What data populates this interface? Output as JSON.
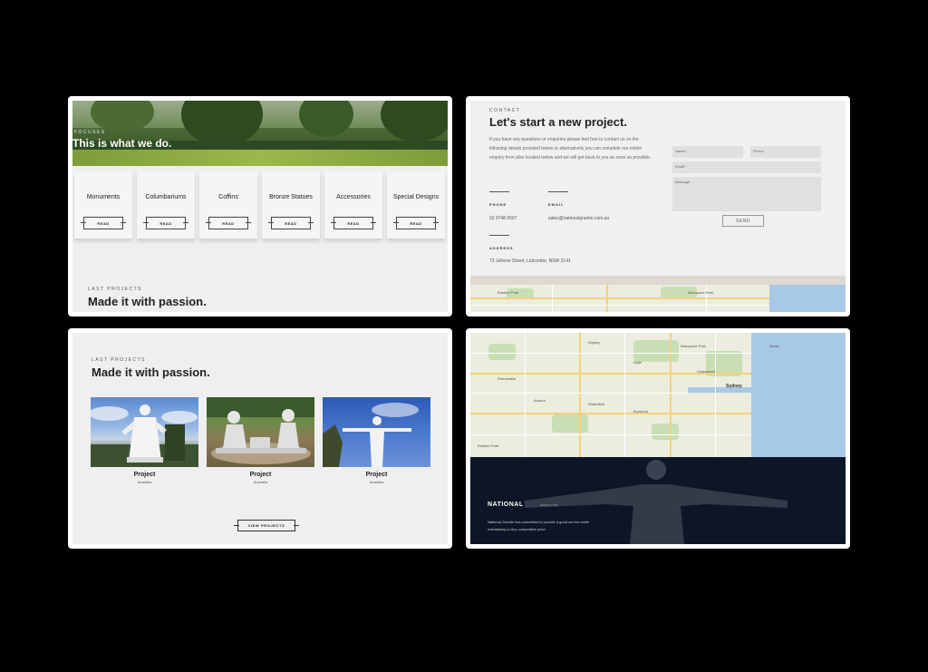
{
  "services": {
    "eyebrow": "Focuses",
    "title": "This is what we do.",
    "read_label": "READ",
    "cards": [
      {
        "label": "Monuments"
      },
      {
        "label": "Columbariums"
      },
      {
        "label": "Coffins"
      },
      {
        "label": "Bronze Statues"
      },
      {
        "label": "Accessories"
      },
      {
        "label": "Special Designs"
      }
    ],
    "last_projects_eyebrow": "Last Projects",
    "last_projects_title": "Made it with passion."
  },
  "contact": {
    "eyebrow": "Contact",
    "title": "Let's start a new project.",
    "intro": "If you have any questions or enquiries please feel free to contact us on the following details provided below or alternatively you can complete our online enquiry form also located below and we will get back to you as soon as possible.",
    "phone_label": "PHONE",
    "phone": "02 9748 6567",
    "email_label": "EMAIL",
    "email": "sales@nationalgranite.com.au",
    "address_label": "ADDRESS",
    "address": "73 Jellicoe Street, Lidcombe, NSW 2141",
    "form": {
      "name_placeholder": "Name*",
      "phone_placeholder": "Phone",
      "email_placeholder": "Email*",
      "message_placeholder": "Message",
      "send_label": "SEND"
    }
  },
  "projects": {
    "eyebrow": "Last Projects",
    "title": "Made it with passion.",
    "items": [
      {
        "name": "Project",
        "location": "Australia"
      },
      {
        "name": "Project",
        "location": "Australia"
      },
      {
        "name": "Project",
        "location": "Australia"
      }
    ],
    "view_label": "VIEW PROJECTS"
  },
  "map": {
    "labels": [
      "Eastern Park",
      "Sydney",
      "Epping",
      "Ryde",
      "Macquarie Park",
      "Chatswood",
      "Parramatta",
      "Auburn",
      "Strathfield",
      "Burwood",
      "Manly"
    ]
  },
  "footer": {
    "brand": "NATIONAL",
    "brand_sub": "GRANITE",
    "text": "National Granite has committed to provide a good service while maintaining a very competitive price."
  },
  "colors": {
    "background": "#000000",
    "panel": "#efefef",
    "footer": "#0d1626",
    "sea": "#a8c8e8"
  }
}
